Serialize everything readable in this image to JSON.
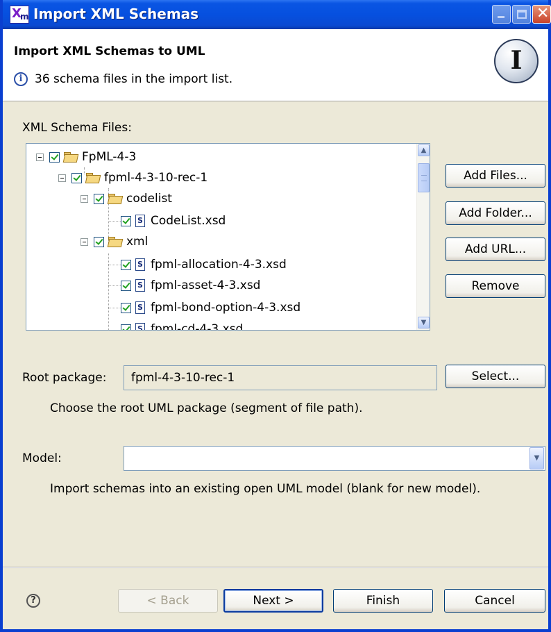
{
  "window": {
    "title": "Import XML Schemas",
    "app_icon": "xml-model-icon"
  },
  "banner": {
    "title": "Import XML Schemas to UML",
    "message": "36 schema files in the import list.",
    "wizard_icon": "I"
  },
  "schema_files": {
    "label": "XML Schema Files:",
    "tree": [
      {
        "label": "FpML-4-3",
        "kind": "folder",
        "checked": true
      },
      {
        "label": "fpml-4-3-10-rec-1",
        "kind": "folder",
        "checked": true
      },
      {
        "label": "codelist",
        "kind": "folder",
        "checked": true
      },
      {
        "label": "CodeList.xsd",
        "kind": "file",
        "checked": true
      },
      {
        "label": "xml",
        "kind": "folder",
        "checked": true
      },
      {
        "label": "fpml-allocation-4-3.xsd",
        "kind": "file",
        "checked": true
      },
      {
        "label": "fpml-asset-4-3.xsd",
        "kind": "file",
        "checked": true
      },
      {
        "label": "fpml-bond-option-4-3.xsd",
        "kind": "file",
        "checked": true
      },
      {
        "label": "fpml-cd-4-3.xsd",
        "kind": "file",
        "checked": true
      }
    ],
    "file_icon_letter": "S",
    "buttons": {
      "add_files": "Add Files...",
      "add_folder": "Add Folder...",
      "add_url": "Add URL...",
      "remove": "Remove"
    }
  },
  "root_package": {
    "label": "Root package:",
    "value": "fpml-4-3-10-rec-1",
    "select_button": "Select...",
    "hint": "Choose the root UML package (segment of file path)."
  },
  "model": {
    "label": "Model:",
    "value": "",
    "hint": "Import schemas into an existing open UML model (blank for new model)."
  },
  "footer": {
    "back": "< Back",
    "next": "Next >",
    "finish": "Finish",
    "cancel": "Cancel"
  }
}
